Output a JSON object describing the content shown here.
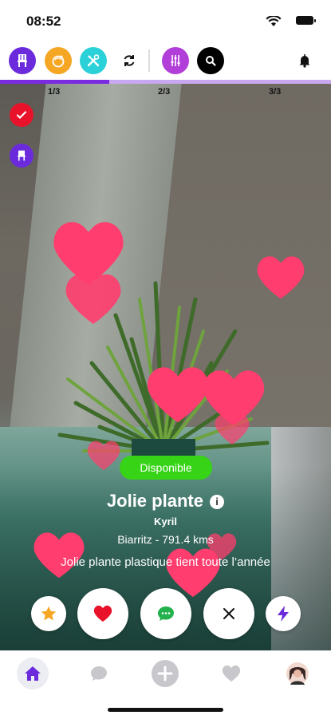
{
  "status_bar": {
    "time": "08:52"
  },
  "toolbar": {
    "buttons": [
      {
        "name": "chair-filter",
        "color": "#6b2bdc"
      },
      {
        "name": "food-filter",
        "color": "#f5a623"
      },
      {
        "name": "tools-filter",
        "color": "#2ad1d9"
      },
      {
        "name": "refresh"
      },
      {
        "name": "settings-filter",
        "color": "#b13ed8"
      },
      {
        "name": "search",
        "color": "#000000"
      },
      {
        "name": "notifications"
      }
    ],
    "progress_fraction": 0.33
  },
  "photo": {
    "page_indicators": [
      "1/3",
      "2/3",
      "3/3"
    ]
  },
  "listing": {
    "status": "Disponible",
    "title": "Jolie plante",
    "info_glyph": "i",
    "owner": "Kyril",
    "location": "Biarritz - 791.4 kms",
    "description": "Jolie plante plastique tient toute l’année"
  },
  "actions": [
    {
      "name": "favorite",
      "color": "#f5a623"
    },
    {
      "name": "like",
      "color": "#e8132a"
    },
    {
      "name": "message",
      "color": "#22b14c"
    },
    {
      "name": "dismiss",
      "color": "#111111"
    },
    {
      "name": "boost",
      "color": "#6b2bdc"
    }
  ],
  "tab_bar": {
    "tabs": [
      "home",
      "messages",
      "add",
      "favorites",
      "profile"
    ],
    "active": "home",
    "accent": "#6b2bdc"
  },
  "colors": {
    "heart": "#ff3d6e",
    "available": "#37d317"
  }
}
